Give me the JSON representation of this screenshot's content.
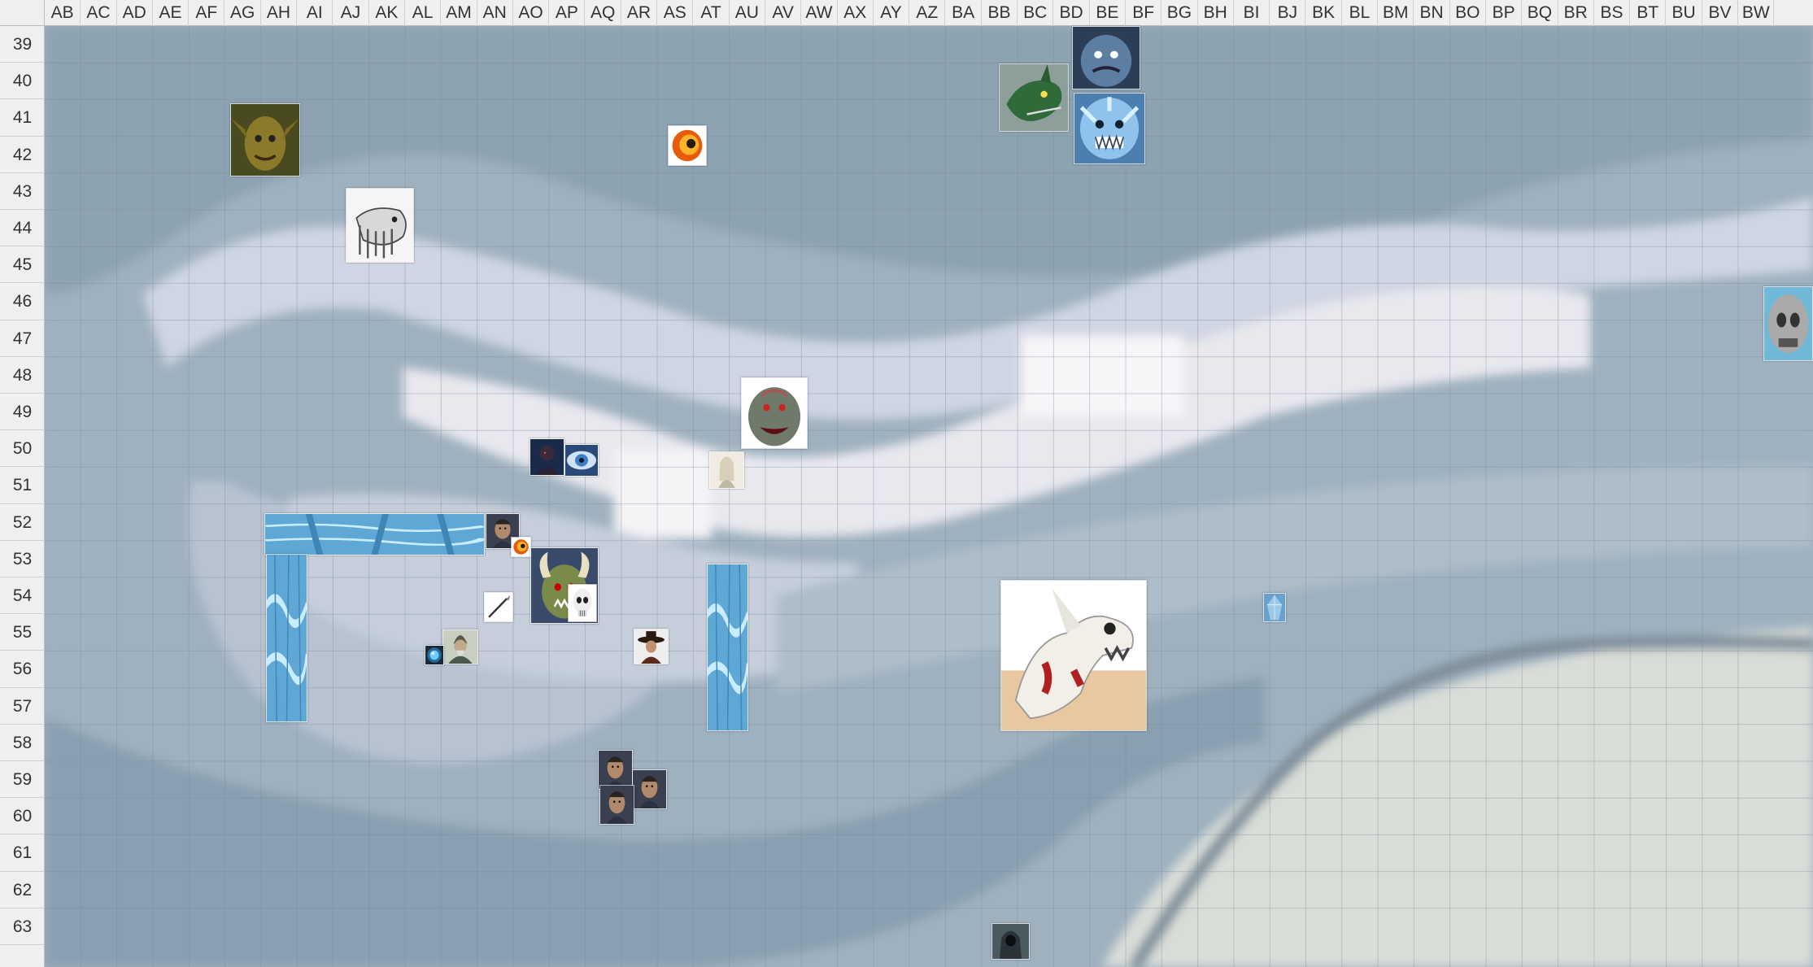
{
  "columns": [
    "AB",
    "AC",
    "AD",
    "AE",
    "AF",
    "AG",
    "AH",
    "AI",
    "AJ",
    "AK",
    "AL",
    "AM",
    "AN",
    "AO",
    "AP",
    "AQ",
    "AR",
    "AS",
    "AT",
    "AU",
    "AV",
    "AW",
    "AX",
    "AY",
    "AZ",
    "BA",
    "BB",
    "BC",
    "BD",
    "BE",
    "BF",
    "BG",
    "BH",
    "BI",
    "BJ",
    "BK",
    "BL",
    "BM",
    "BN",
    "BO",
    "BP",
    "BQ",
    "BR",
    "BS",
    "BT",
    "BU",
    "BV",
    "BW"
  ],
  "rows": [
    "39",
    "40",
    "41",
    "42",
    "43",
    "44",
    "45",
    "46",
    "47",
    "48",
    "49",
    "50",
    "51",
    "52",
    "53",
    "54",
    "55",
    "56",
    "57",
    "58",
    "59",
    "60",
    "61",
    "62",
    "63"
  ],
  "colors": {
    "header_bg": "#efefef",
    "map_dark": "#7f97a8",
    "map_mid": "#a8b8c6",
    "map_light": "#d3d8e4",
    "ice": "#5fa8d6"
  },
  "tokens": [
    {
      "name": "goblin-token",
      "icon": "goblin-face"
    },
    {
      "name": "fireball-token",
      "icon": "fireball"
    },
    {
      "name": "green-dragon-token",
      "icon": "dragon-head"
    },
    {
      "name": "blue-troll-token",
      "icon": "troll-face"
    },
    {
      "name": "ice-troll-token",
      "icon": "ice-beast"
    },
    {
      "name": "skeletal-beast-token",
      "icon": "sketch-beast"
    },
    {
      "name": "skull-stone-token",
      "icon": "stone-skull"
    },
    {
      "name": "ogre-token",
      "icon": "ogre-face"
    },
    {
      "name": "dark-figure-token",
      "icon": "dark-figure"
    },
    {
      "name": "blue-eye-token",
      "icon": "eye"
    },
    {
      "name": "elf-token",
      "icon": "elf"
    },
    {
      "name": "ice-wall-horizontal",
      "icon": "ice-wall"
    },
    {
      "name": "ice-wall-left",
      "icon": "ice-wall"
    },
    {
      "name": "ice-wall-right",
      "icon": "ice-wall"
    },
    {
      "name": "bearded-man-token",
      "icon": "man-face"
    },
    {
      "name": "small-fire-token",
      "icon": "fireball"
    },
    {
      "name": "horned-orc-token",
      "icon": "horned-orc"
    },
    {
      "name": "skull-token",
      "icon": "skull"
    },
    {
      "name": "spear-token",
      "icon": "spear"
    },
    {
      "name": "wizard-token",
      "icon": "wizard"
    },
    {
      "name": "blue-orb-token",
      "icon": "orb"
    },
    {
      "name": "hunter-token",
      "icon": "hat-man"
    },
    {
      "name": "bone-dragon-token",
      "icon": "bone-dragon"
    },
    {
      "name": "ice-shard-token",
      "icon": "ice-shard"
    },
    {
      "name": "man-face-token-1",
      "icon": "man-face"
    },
    {
      "name": "man-face-token-2",
      "icon": "man-face"
    },
    {
      "name": "man-face-token-3",
      "icon": "man-face"
    },
    {
      "name": "hooded-figure-token",
      "icon": "hooded-figure"
    }
  ]
}
